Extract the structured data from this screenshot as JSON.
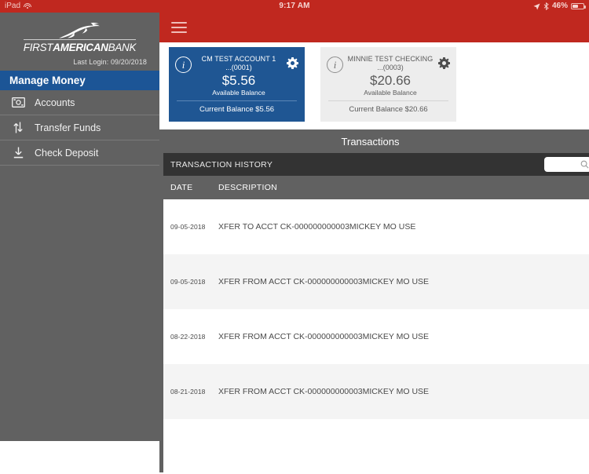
{
  "status_bar": {
    "device": "iPad",
    "wifi_icon": "wifi-icon",
    "time": "9:17 AM",
    "location_icon": "location-arrow-icon",
    "bluetooth_icon": "bluetooth-icon",
    "battery_percent": "46%"
  },
  "sidebar": {
    "logo_mark": "horse-logo-icon",
    "logo_first": "FIRST",
    "logo_american": "AMERICAN",
    "logo_bank": "BANK",
    "last_login": "Last Login:  09/20/2018",
    "section_title": "Manage Money",
    "items": [
      {
        "label": "Accounts",
        "icon": "money-bill-icon"
      },
      {
        "label": "Transfer Funds",
        "icon": "transfer-arrows-icon"
      },
      {
        "label": "Check Deposit",
        "icon": "download-arrow-icon"
      }
    ]
  },
  "topbar": {
    "menu_icon": "hamburger-menu-icon"
  },
  "cards": [
    {
      "name": "CM TEST ACCOUNT 1",
      "number": "...(0001)",
      "balance": "$5.56",
      "balance_label": "Available Balance",
      "current_balance": "Current Balance $5.56",
      "info_icon": "info-icon",
      "gear_icon": "gear-icon",
      "theme": "blue"
    },
    {
      "name": "MINNIE TEST CHECKING",
      "number": "...(0003)",
      "balance": "$20.66",
      "balance_label": "Available Balance",
      "current_balance": "Current Balance $20.66",
      "info_icon": "info-icon",
      "gear_icon": "gear-icon",
      "theme": "grey"
    }
  ],
  "transactions": {
    "title": "Transactions",
    "history_label": "TRANSACTION HISTORY",
    "search_icon": "search-icon",
    "search_value": "",
    "search_placeholder": "",
    "columns": {
      "date": "DATE",
      "description": "DESCRIPTION"
    },
    "rows": [
      {
        "date": "09-05-2018",
        "description": "XFER TO ACCT CK-000000000003MICKEY MO USE"
      },
      {
        "date": "09-05-2018",
        "description": "XFER FROM ACCT CK-000000000003MICKEY MO USE"
      },
      {
        "date": "08-22-2018",
        "description": "XFER FROM ACCT CK-000000000003MICKEY MO USE"
      },
      {
        "date": "08-21-2018",
        "description": "XFER FROM ACCT CK-000000000003MICKEY MO USE"
      }
    ]
  },
  "colors": {
    "brand_red": "#c0281f",
    "card_blue": "#1f5693",
    "nav_blue": "#1c5596",
    "sidebar_grey": "#616161",
    "history_bar": "#333333"
  }
}
